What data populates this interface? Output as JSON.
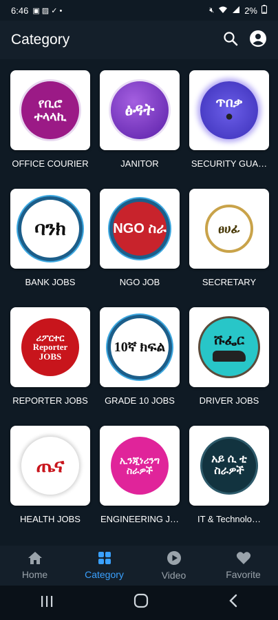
{
  "status_bar": {
    "time": "6:46",
    "battery": "2%"
  },
  "app_bar": {
    "title": "Category"
  },
  "categories": [
    {
      "label": "OFFICE COURIER",
      "logo_text": "የቢሮ ተላላኪ",
      "logo_color": "#9b1a86"
    },
    {
      "label": "JANITOR",
      "logo_text": "ፅዳት",
      "logo_color": "#7d3ab8"
    },
    {
      "label": "SECURITY GUA…",
      "logo_text": "ጥበቃ",
      "logo_color": "#5b3fd0"
    },
    {
      "label": "BANK JOBS",
      "logo_text": "ባንክ",
      "logo_color": "#ffffff"
    },
    {
      "label": "NGO JOB",
      "logo_text": "NGO ስራ",
      "logo_color": "#c8232c"
    },
    {
      "label": "SECRETARY",
      "logo_text": "ፀሀፊ",
      "logo_color": "#ffffff"
    },
    {
      "label": "REPORTER JOBS",
      "logo_text": "ሪፖርተር Reporter JOBS",
      "logo_color": "#c8151c"
    },
    {
      "label": "GRADE 10 JOBS",
      "logo_text": "10ኛ ክፍል",
      "logo_color": "#ffffff"
    },
    {
      "label": "DRIVER JOBS",
      "logo_text": "ሹፌር",
      "logo_color": "#28c6c8"
    },
    {
      "label": "HEALTH JOBS",
      "logo_text": "ጤና",
      "logo_color": "#ffffff"
    },
    {
      "label": "ENGINEERING J…",
      "logo_text": "ኢንጂነሪንግ ስራዎች",
      "logo_color": "#e0249a"
    },
    {
      "label": "IT & Technolo…",
      "logo_text": "አይ ሲ ቲ ስራዎች",
      "logo_color": "#12333f"
    }
  ],
  "bottom_nav": [
    {
      "label": "Home",
      "icon": "home-icon"
    },
    {
      "label": "Category",
      "icon": "grid-icon"
    },
    {
      "label": "Video",
      "icon": "play-icon"
    },
    {
      "label": "Favorite",
      "icon": "heart-icon"
    }
  ],
  "colors": {
    "accent": "#3aa1ff",
    "background": "#0f1a24"
  }
}
